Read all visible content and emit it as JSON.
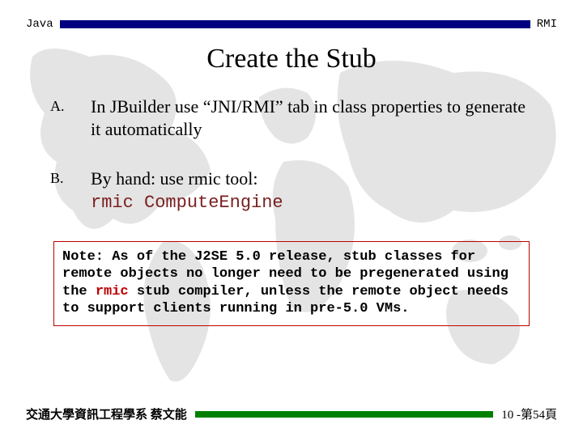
{
  "header": {
    "left": "Java",
    "right": "RMI"
  },
  "title": "Create the Stub",
  "items": [
    {
      "marker": "A.",
      "text": "In JBuilder use “JNI/RMI” tab in class properties to generate it automatically"
    },
    {
      "marker": "B.",
      "text_line1": "By hand: use rmic tool:",
      "code": "rmic ComputeEngine"
    }
  ],
  "note": {
    "prefix": "Note: As of the J2SE 5.0 release, stub classes for remote objects no longer need to be pregenerated using the ",
    "rmic": "rmic",
    "suffix": " stub compiler, unless the remote object needs to support clients running in pre-5.0 VMs."
  },
  "footer": {
    "left": "交通大學資訊工程學系 蔡文能",
    "right": "10 -第54頁"
  }
}
